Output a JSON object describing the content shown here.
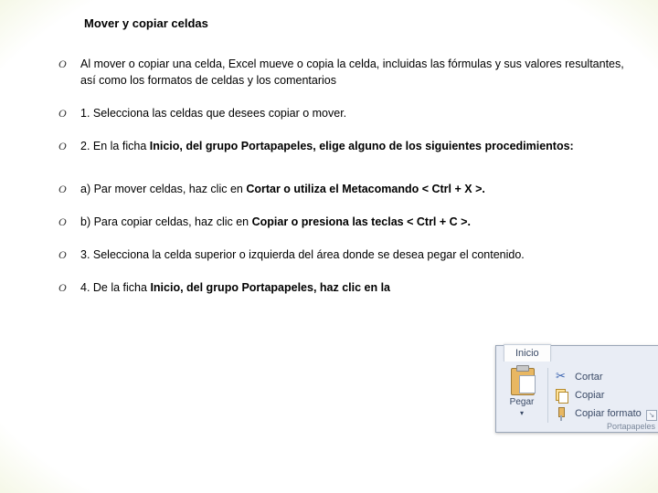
{
  "title": "Mover y copiar celdas",
  "bullets": [
    {
      "html": "Al mover o copiar una celda, Excel mueve o copia la celda, incluidas las fórmulas y sus valores resultantes, así como los formatos de celdas y los comentarios"
    },
    {
      "html": "1. Selecciona las celdas que desees copiar o mover."
    },
    {
      "html": "2. En la ficha <b>Inicio, del grupo Portapapeles, elige alguno de los siguientes procedimientos:</b>"
    },
    {
      "spacer": true
    },
    {
      "html": "a) Par mover celdas, haz clic en <b>Cortar o utiliza el Metacomando &lt; Ctrl + X &gt;.</b>"
    },
    {
      "html": "b) Para copiar celdas, haz clic en <b>Copiar o presiona las teclas &lt; Ctrl + C &gt;.</b>"
    },
    {
      "html": "3. Selecciona la celda superior o izquierda del área donde se desea pegar el contenido."
    },
    {
      "html": "4. De la ficha <b>Inicio, del grupo Portapapeles, haz clic en la</b>"
    }
  ],
  "ribbon": {
    "tab": "Inicio",
    "paste": "Pegar",
    "cut": "Cortar",
    "copy": "Copiar",
    "format": "Copiar formato",
    "group": "Portapapeles"
  }
}
